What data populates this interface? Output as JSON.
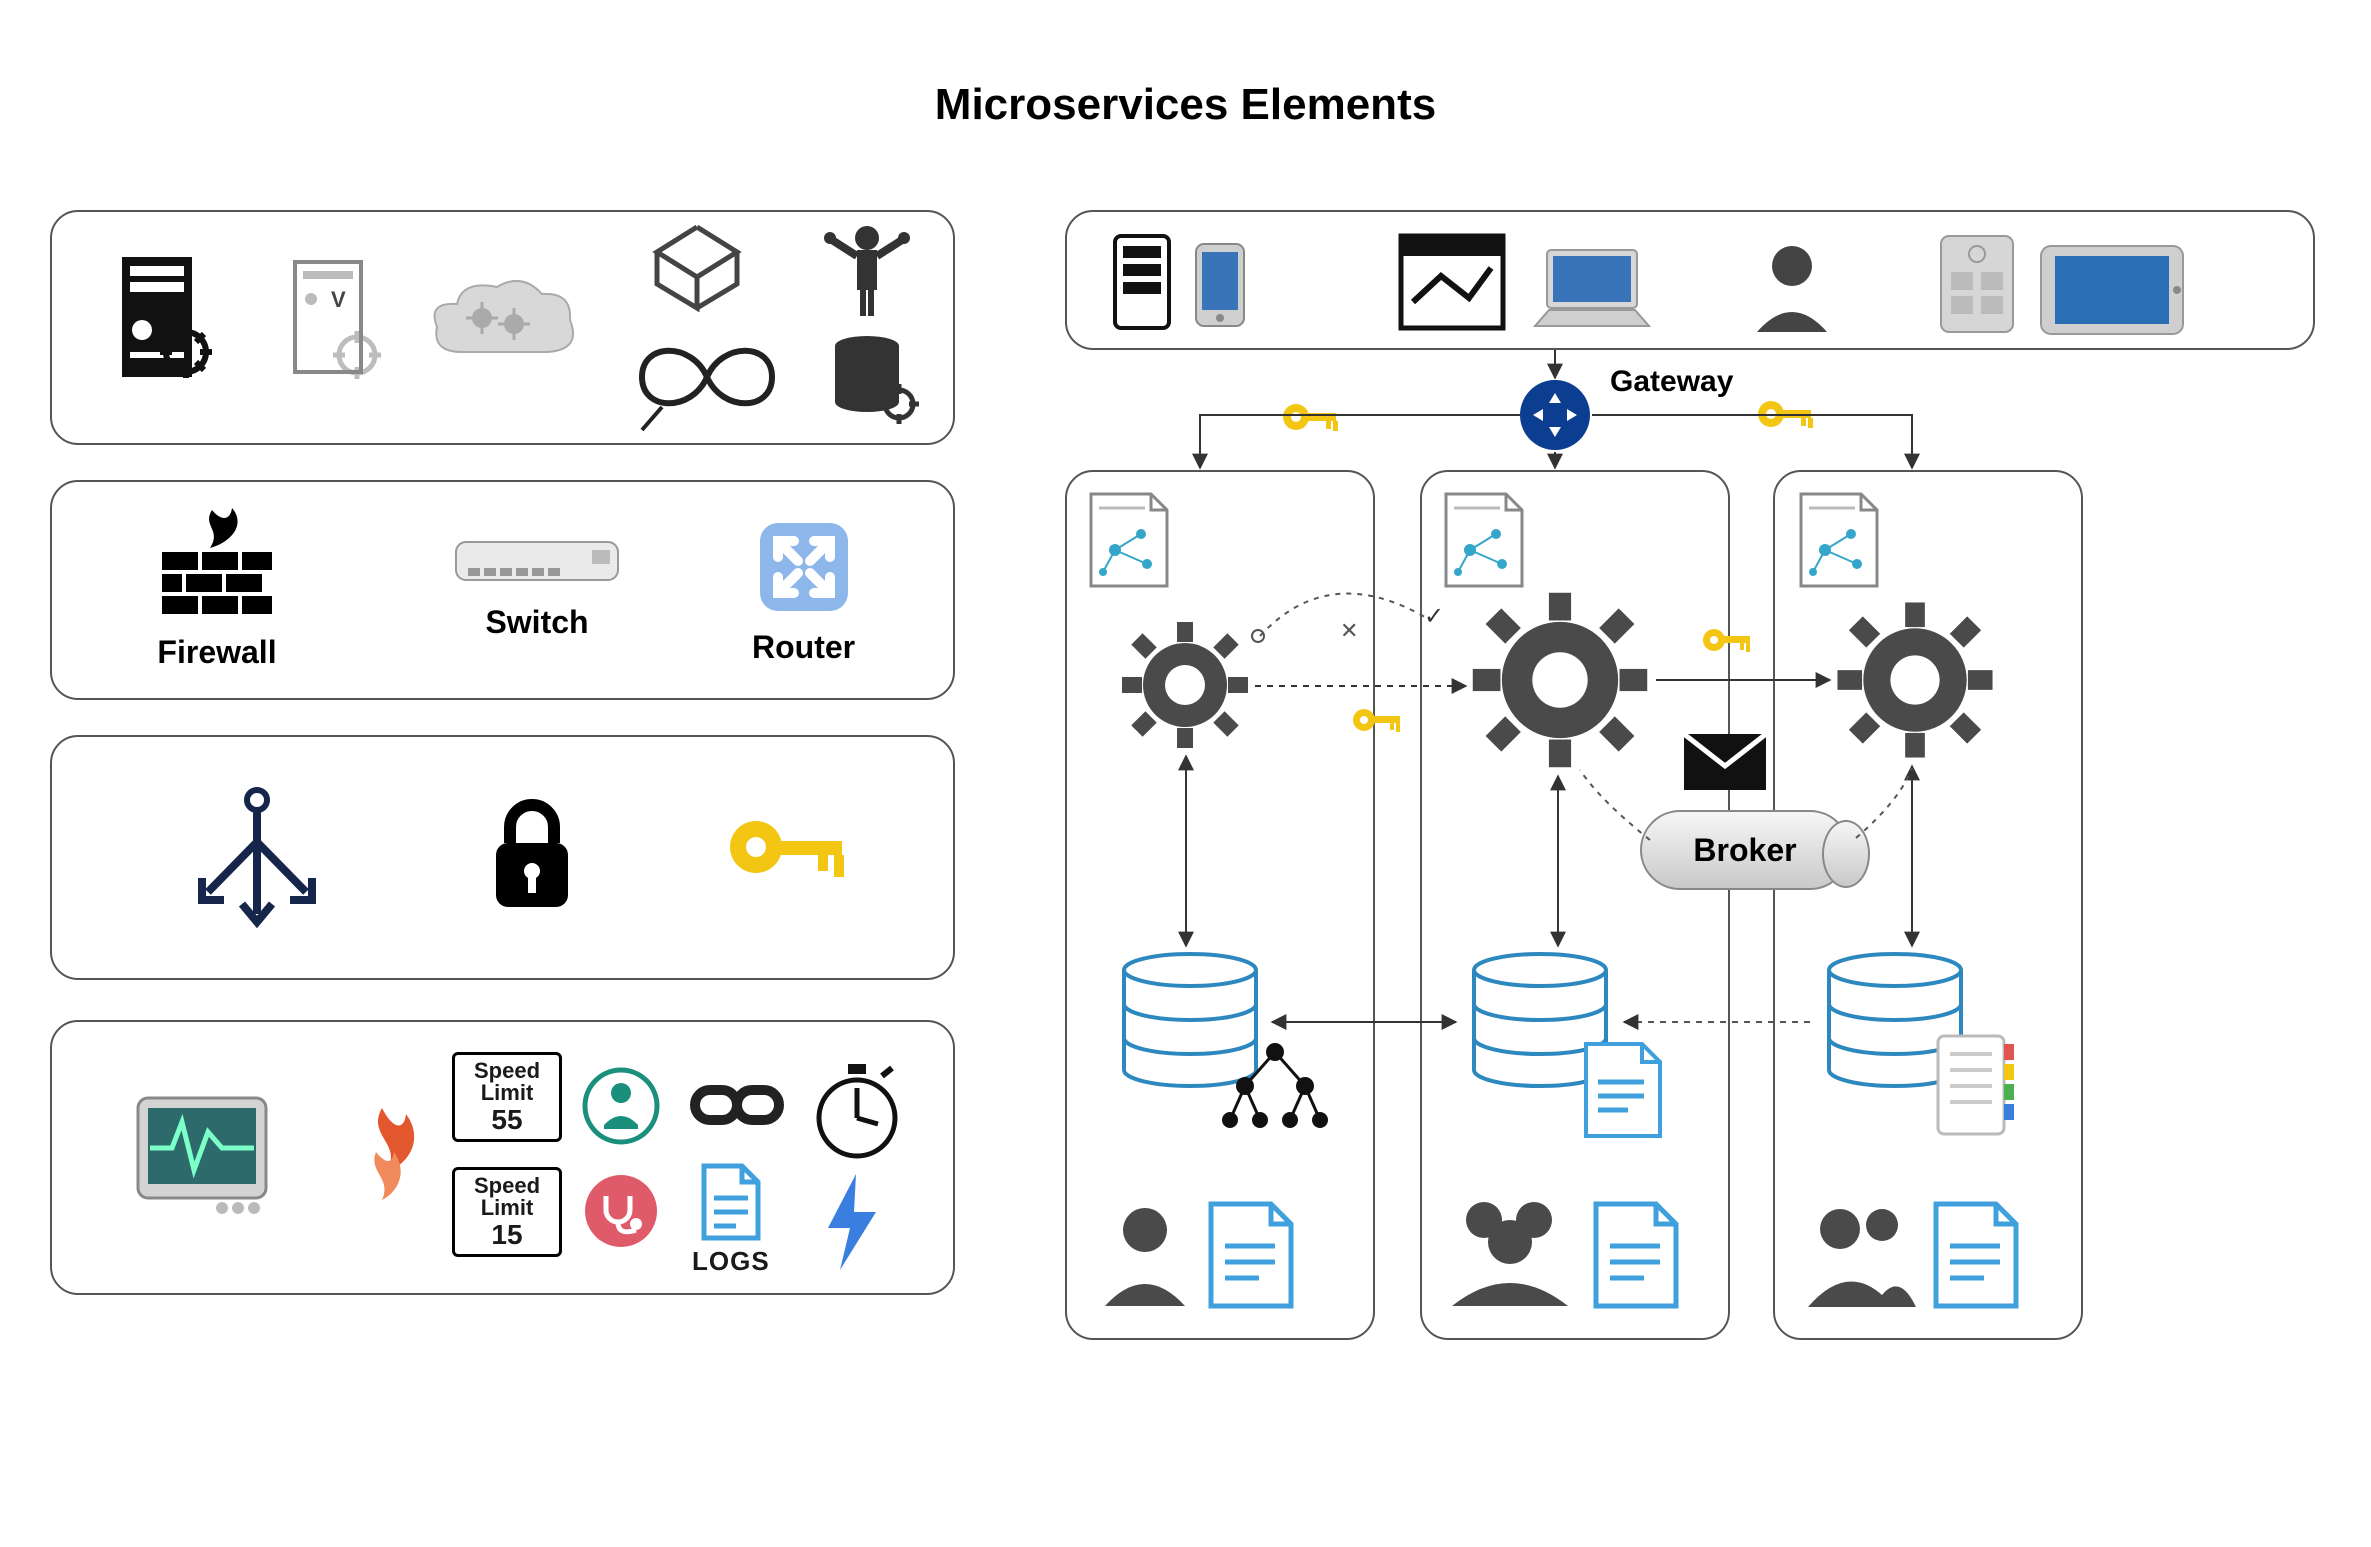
{
  "title": "Microservices Elements",
  "network": {
    "firewall_label": "Firewall",
    "switch_label": "Switch",
    "router_label": "Router"
  },
  "monitoring": {
    "speed_limit_1_label": "Speed Limit",
    "speed_limit_1_value": "55",
    "speed_limit_2_label": "Speed Limit",
    "speed_limit_2_value": "15",
    "logs_label": "LOGS"
  },
  "architecture": {
    "gateway_label": "Gateway",
    "broker_label": "Broker"
  },
  "icons": {
    "server": "server-icon",
    "vm": "vm-server-icon",
    "cloud_gears": "cloud-gears-icon",
    "open_box": "open-box-icon",
    "infinity": "infinity-icon",
    "orchestrator": "orchestrator-person-icon",
    "db_gear": "database-gear-icon",
    "firewall": "firewall-icon",
    "switch": "switch-icon",
    "router": "router-icon",
    "load_balancer": "load-balancer-icon",
    "lock": "lock-icon",
    "key": "key-icon",
    "monitor": "monitor-pulse-icon",
    "flame": "flame-icon",
    "health": "health-icon",
    "diag": "diagnostics-icon",
    "link": "chain-link-icon",
    "logs": "logs-file-icon",
    "stopwatch": "stopwatch-icon",
    "bolt": "bolt-icon",
    "gear": "gear-icon",
    "contract": "contract-doc-icon",
    "db": "database-cylinder-icon",
    "user": "user-icon",
    "users": "users-icon",
    "mail": "mail-icon",
    "doc": "document-icon",
    "phone": "phone-icon",
    "laptop": "laptop-icon",
    "browser": "browser-icon",
    "tablet": "tablet-icon"
  }
}
